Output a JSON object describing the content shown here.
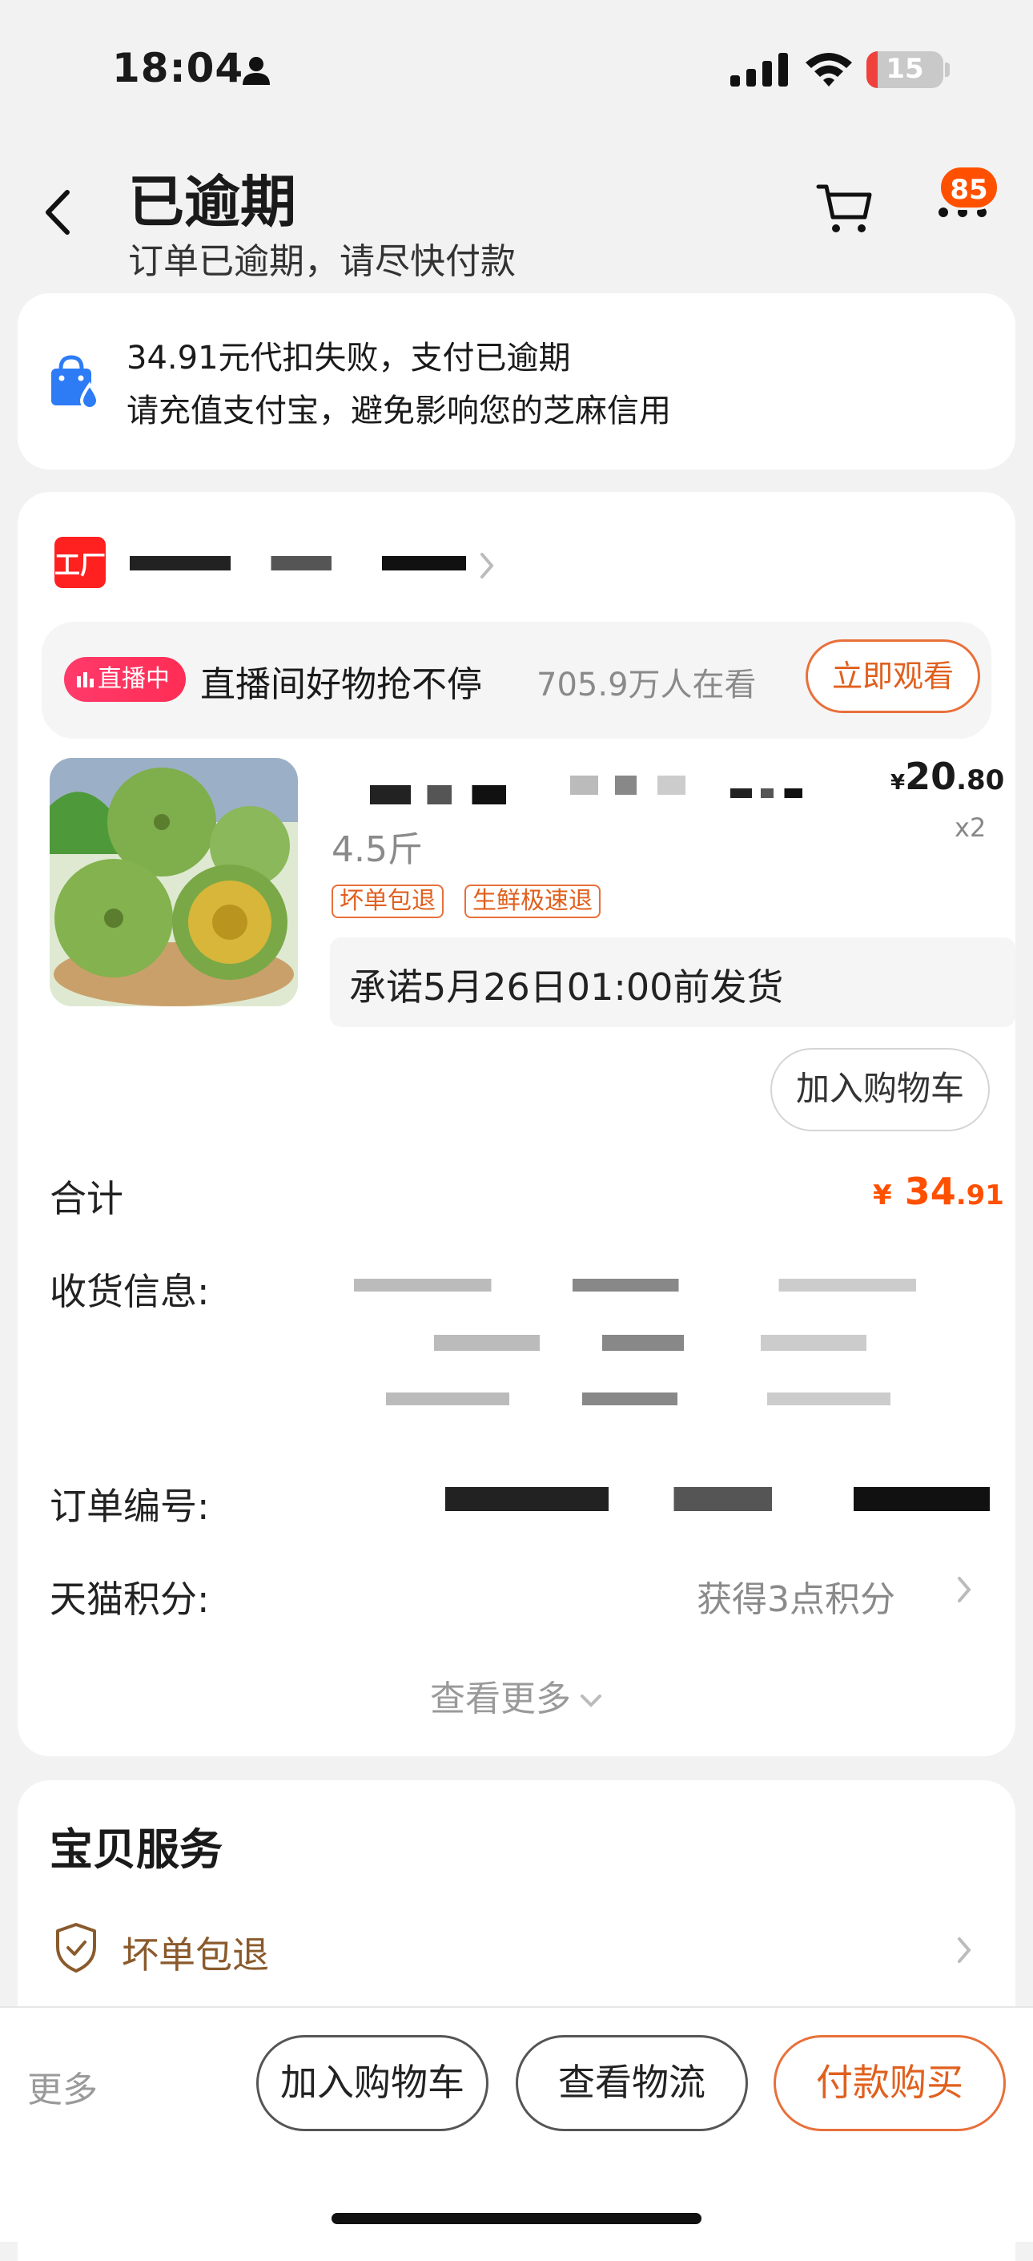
{
  "status_bar": {
    "time": "18:04",
    "battery": "15",
    "battery_level": 0.15
  },
  "header": {
    "title": "已逾期",
    "subtitle": "订单已逾期，请尽快付款",
    "more_badge": "85"
  },
  "alert": {
    "line1": "34.91元代扣失败，支付已逾期",
    "line2": "请充值支付宝，避免影响您的芝麻信用"
  },
  "store": {
    "logo_text": "工厂"
  },
  "live": {
    "badge": "直播中",
    "title": "直播间好物抢不停",
    "viewers": "705.9万人在看",
    "watch_button": "立即观看"
  },
  "product": {
    "price_currency": "¥",
    "price_int": "20",
    "price_dec": ".80",
    "quantity": "x2",
    "spec": "4.5斤",
    "tags": [
      "坏单包退",
      "生鲜极速退"
    ],
    "promise": "承诺5月26日01:00前发货",
    "add_cart": "加入购物车"
  },
  "order": {
    "total_label": "合计",
    "total_currency": "¥",
    "total_int": "34",
    "total_dec": ".91",
    "address_label": "收货信息:",
    "order_no_label": "订单编号:",
    "points_label": "天猫积分:",
    "points_value": "获得3点积分",
    "see_more": "查看更多"
  },
  "services": {
    "title": "宝贝服务",
    "item": "坏单包退"
  },
  "bottom_bar": {
    "more": "更多",
    "add_cart": "加入购物车",
    "logistics": "查看物流",
    "pay": "付款购买"
  }
}
